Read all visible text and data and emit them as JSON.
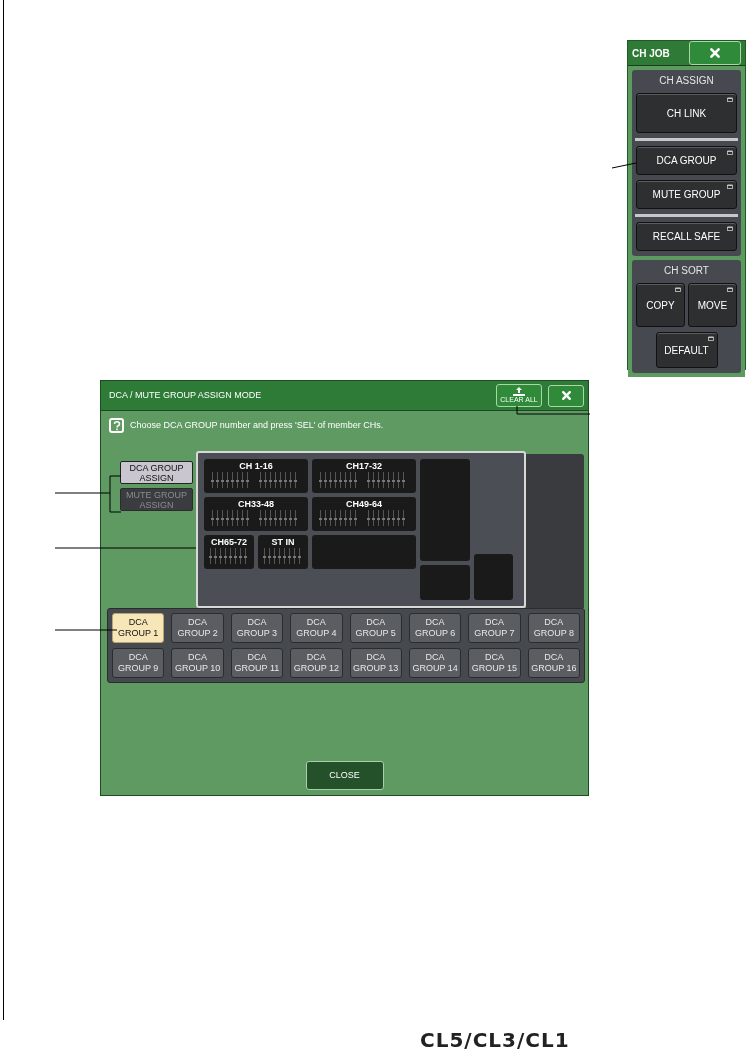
{
  "ch_job": {
    "title": "CH JOB",
    "sections": [
      {
        "title": "CH ASSIGN",
        "buttons": [
          {
            "label": "CH LINK",
            "kind": "tall"
          },
          {
            "label": "DCA GROUP",
            "kind": "normal",
            "divider_before": true
          },
          {
            "label": "MUTE GROUP",
            "kind": "normal"
          },
          {
            "label": "RECALL SAFE",
            "kind": "normal",
            "divider_before": true
          }
        ]
      },
      {
        "title": "CH SORT",
        "buttons": [
          {
            "label": "COPY",
            "kind": "half"
          },
          {
            "label": "MOVE",
            "kind": "half"
          },
          {
            "label": "DEFAULT",
            "kind": "center"
          }
        ]
      }
    ]
  },
  "dialog": {
    "title": "DCA / MUTE GROUP ASSIGN MODE",
    "clear_all": "CLEAR ALL",
    "help_text": "Choose DCA GROUP number and press 'SEL' of member CHs.",
    "mode_buttons": [
      {
        "label": "DCA GROUP\nASSIGN",
        "selected": true
      },
      {
        "label": "MUTE GROUP\nASSIGN",
        "selected": false
      }
    ],
    "channel_blocks": [
      {
        "label": "CH 1-16",
        "kind": "wide"
      },
      {
        "label": "CH17-32",
        "kind": "wide"
      },
      {
        "label": "CH33-48",
        "kind": "wide"
      },
      {
        "label": "CH49-64",
        "kind": "wide"
      },
      {
        "label": "CH65-72",
        "kind": "narrow"
      },
      {
        "label": "ST IN",
        "kind": "narrow"
      }
    ],
    "dca_groups": [
      {
        "label": "DCA\nGROUP 1",
        "selected": true
      },
      {
        "label": "DCA\nGROUP 2",
        "selected": false
      },
      {
        "label": "DCA\nGROUP 3",
        "selected": false
      },
      {
        "label": "DCA\nGROUP 4",
        "selected": false
      },
      {
        "label": "DCA\nGROUP 5",
        "selected": false
      },
      {
        "label": "DCA\nGROUP 6",
        "selected": false
      },
      {
        "label": "DCA\nGROUP 7",
        "selected": false
      },
      {
        "label": "DCA\nGROUP 8",
        "selected": false
      },
      {
        "label": "DCA\nGROUP 9",
        "selected": false
      },
      {
        "label": "DCA\nGROUP 10",
        "selected": false
      },
      {
        "label": "DCA\nGROUP 11",
        "selected": false
      },
      {
        "label": "DCA\nGROUP 12",
        "selected": false
      },
      {
        "label": "DCA\nGROUP 13",
        "selected": false
      },
      {
        "label": "DCA\nGROUP 14",
        "selected": false
      },
      {
        "label": "DCA\nGROUP 15",
        "selected": false
      },
      {
        "label": "DCA\nGROUP 16",
        "selected": false
      }
    ],
    "close": "CLOSE"
  },
  "footer_logo": "CL5/CL3/CL1"
}
